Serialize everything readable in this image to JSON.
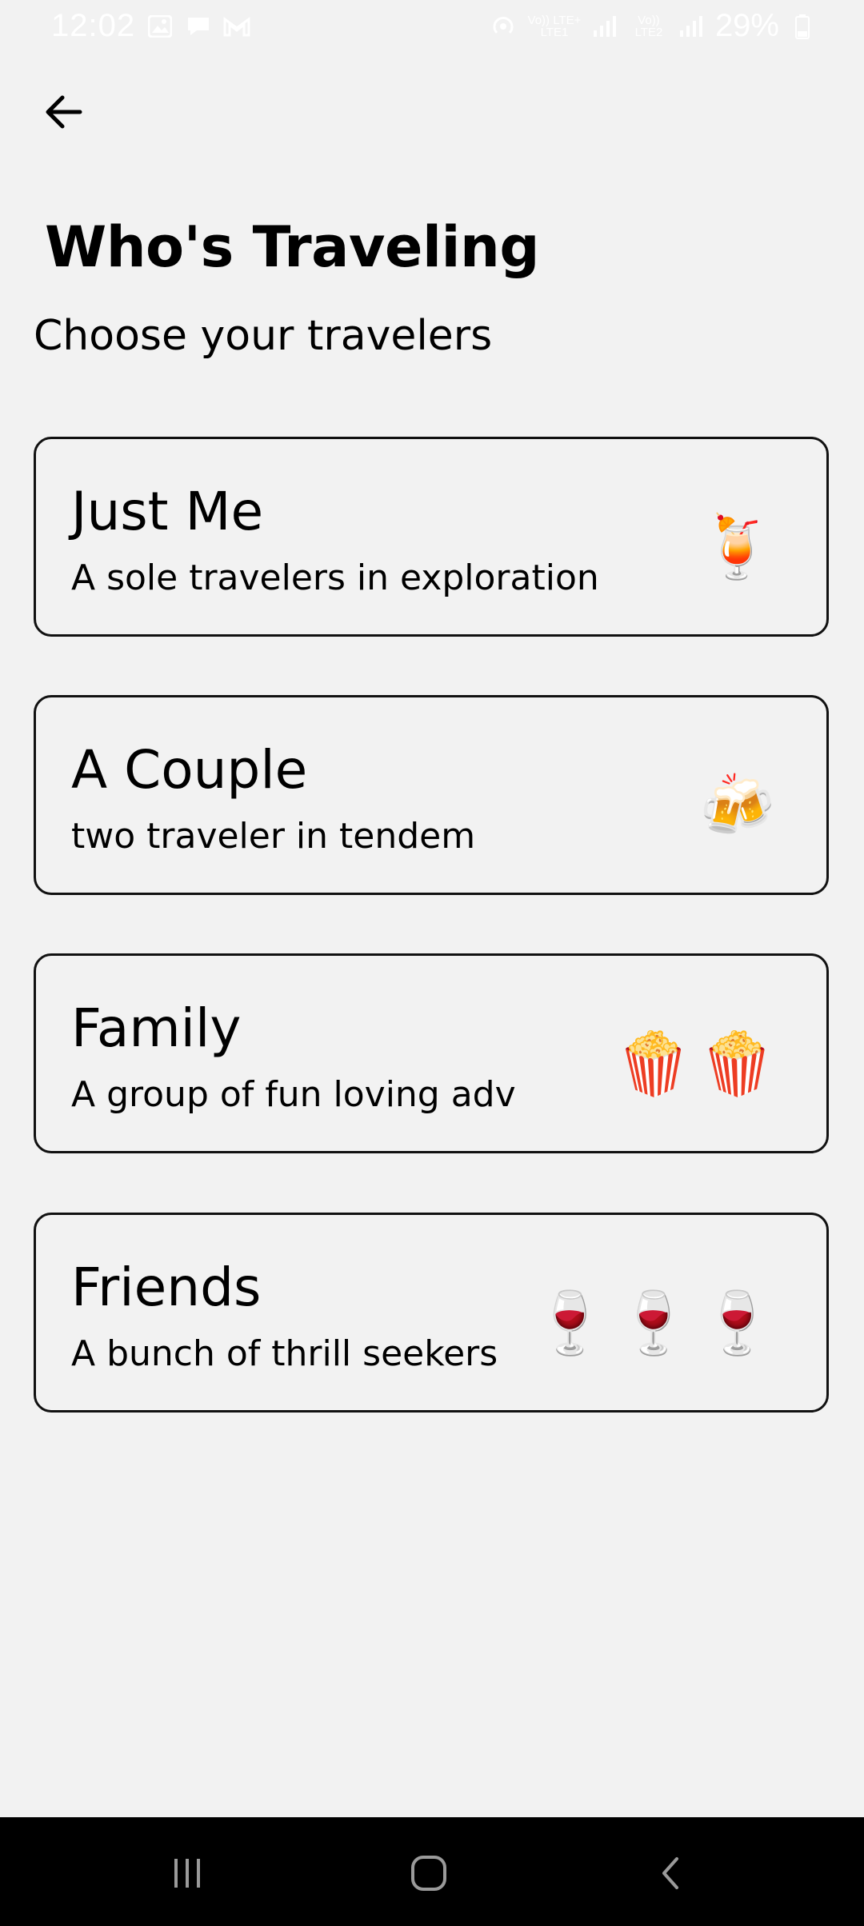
{
  "status_bar": {
    "time": "12:02",
    "battery": "29%",
    "lte1": "Vo)) LTE+ LTE1",
    "lte2": "Vo)) LTE2",
    "icons": [
      "gallery-icon",
      "chat-icon",
      "gmail-icon",
      "hotspot-icon",
      "signal-icon",
      "battery-icon"
    ]
  },
  "header": {
    "back_icon": "arrow-left-icon",
    "title": "Who's Traveling",
    "subtitle": "Choose your travelers"
  },
  "options": [
    {
      "title": "Just Me",
      "description": "A sole travelers in exploration",
      "icon": "🍹"
    },
    {
      "title": "A Couple",
      "description": "two traveler in tendem",
      "icon": "🍻"
    },
    {
      "title": "Family",
      "description": "A group of fun loving adv",
      "icon": "🍿🍿"
    },
    {
      "title": "Friends",
      "description": "A bunch of thrill seekers",
      "icon": "🍷🍷🍷"
    }
  ],
  "nav_bar": {
    "icons": [
      "recents-icon",
      "home-icon",
      "back-icon"
    ]
  },
  "colors": {
    "background": "#f2f2f2",
    "card_border": "#111111",
    "nav_background": "#000000"
  }
}
